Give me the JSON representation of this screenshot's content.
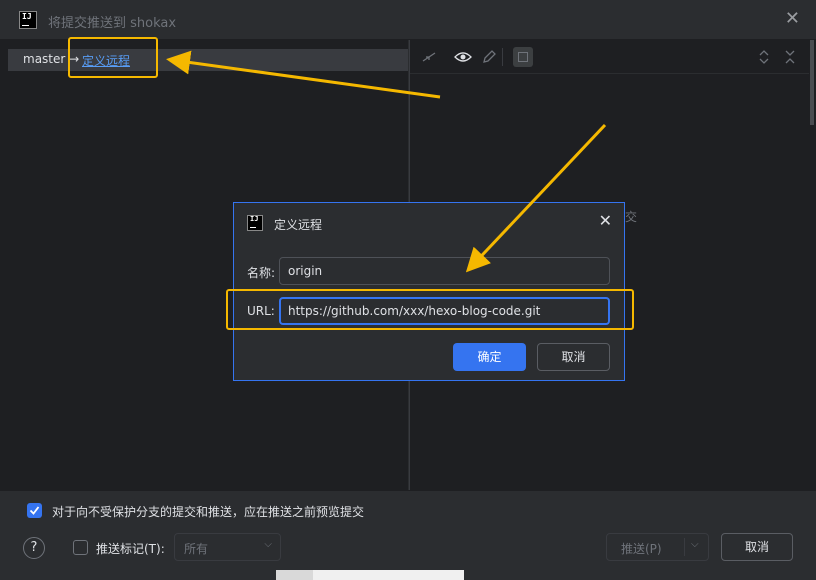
{
  "window": {
    "title": "将提交推送到 shokax",
    "logo_text": "IJ",
    "close_glyph": "✕"
  },
  "push_row": {
    "source_branch": "master →",
    "define_remote_link": "定义远程"
  },
  "right_pane": {
    "hint_text": "交"
  },
  "dialog": {
    "title": "定义远程",
    "logo_text": "IJ",
    "close_glyph": "✕",
    "name_label": "名称:",
    "name_value": "origin",
    "url_label": "URL:",
    "url_value": "https://github.com/xxx/hexo-blog-code.git",
    "ok_label": "确定",
    "cancel_label": "取消"
  },
  "bottom": {
    "preview_checkbox_label": "对于向不受保护分支的提交和推送，应在推送之前预览提交",
    "preview_checked": true,
    "push_tags_label": "推送标记(T):",
    "push_tags_checked": false,
    "tags_select_value": "所有",
    "push_button_label": "推送(P)",
    "cancel_button_label": "取消",
    "help_glyph": "?"
  },
  "colors": {
    "accent": "#3574f0",
    "link": "#589df6",
    "annotation": "#f5b800",
    "background": "#2b2d30",
    "panel": "#1e1f22"
  },
  "icons": {
    "toolbar": [
      "collapse-icon",
      "eye-icon",
      "edit-icon",
      "diff-icon",
      "expand-all-icon",
      "collapse-all-icon"
    ]
  }
}
